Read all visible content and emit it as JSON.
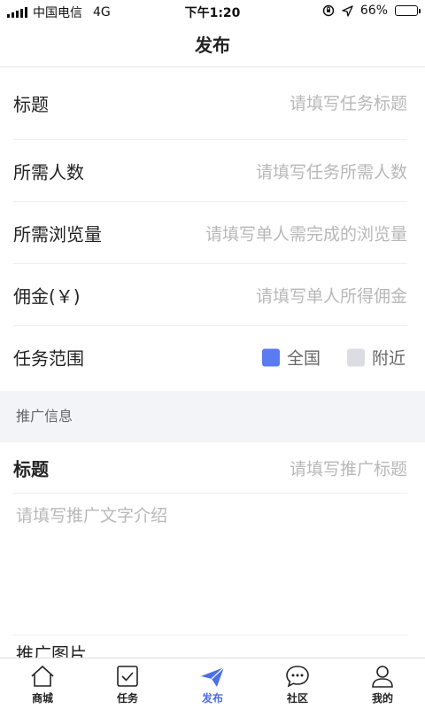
{
  "status_bar": {
    "carrier": "中国电信",
    "network": "4G",
    "time": "下午1:20",
    "battery_percent": "66%",
    "battery_level": 0.66,
    "battery_color": "#f5c518"
  },
  "navbar": {
    "title": "发布"
  },
  "form": {
    "title": {
      "label": "标题",
      "placeholder": "请填写任务标题"
    },
    "people": {
      "label": "所需人数",
      "placeholder": "请填写任务所需人数"
    },
    "views": {
      "label": "所需浏览量",
      "placeholder": "请填写单人需完成的浏览量"
    },
    "commission": {
      "label": "佣金(￥)",
      "placeholder": "请填写单人所得佣金"
    },
    "scope": {
      "label": "任务范围",
      "options": [
        {
          "label": "全国",
          "selected": true,
          "color": "#5b7cf0"
        },
        {
          "label": "附近",
          "selected": false,
          "color": "#dcdde3"
        }
      ]
    }
  },
  "promo": {
    "section_title": "推广信息",
    "title_label": "标题",
    "title_placeholder": "请填写推广标题",
    "text_placeholder": "请填写推广文字介绍",
    "image_label": "推广图片"
  },
  "tabbar": {
    "accent_color": "#4c6fe8",
    "items": [
      {
        "label": "商城",
        "icon": "home-icon"
      },
      {
        "label": "任务",
        "icon": "task-check-icon"
      },
      {
        "label": "发布",
        "icon": "paper-plane-icon",
        "active": true
      },
      {
        "label": "社区",
        "icon": "chat-bubble-icon"
      },
      {
        "label": "我的",
        "icon": "user-icon"
      }
    ]
  }
}
